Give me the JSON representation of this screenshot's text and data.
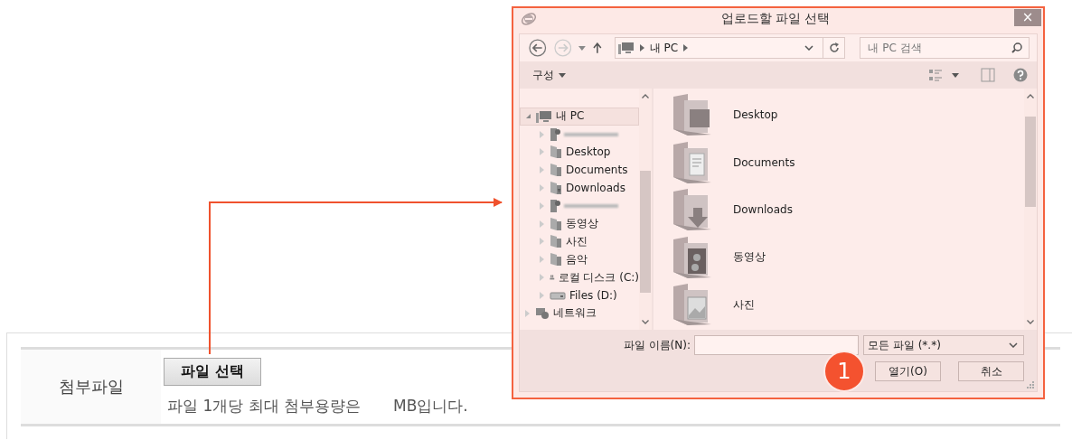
{
  "dialog": {
    "title": "업로드할 파일 선택",
    "close_label": "×",
    "address": {
      "path": [
        "내 PC"
      ]
    },
    "search": {
      "placeholder": "내 PC 검색"
    },
    "toolbar": {
      "organize": "구성"
    },
    "tree": [
      {
        "label": "내 PC",
        "kind": "computer",
        "expanded": true,
        "selected": true,
        "children": [
          {
            "kind": "redacted",
            "expanded": false,
            "selected": false
          },
          {
            "label": "Desktop",
            "kind": "desktop",
            "expanded": false,
            "selected": false
          },
          {
            "label": "Documents",
            "kind": "documents",
            "expanded": false,
            "selected": false
          },
          {
            "label": "Downloads",
            "kind": "downloads",
            "expanded": false,
            "selected": false
          },
          {
            "kind": "redacted",
            "expanded": false,
            "selected": false
          },
          {
            "label": "동영상",
            "kind": "videos",
            "expanded": false,
            "selected": false
          },
          {
            "label": "사진",
            "kind": "pictures",
            "expanded": false,
            "selected": false
          },
          {
            "label": "음악",
            "kind": "music",
            "expanded": false,
            "selected": false
          },
          {
            "label": "로컬 디스크 (C:)",
            "kind": "system-disk",
            "expanded": false,
            "selected": false
          },
          {
            "label": "Files (D:)",
            "kind": "disk",
            "expanded": false,
            "selected": false
          }
        ]
      },
      {
        "label": "네트워크",
        "kind": "network",
        "expanded": false,
        "selected": false
      }
    ],
    "files": [
      {
        "name": "Desktop",
        "kind": "desktop"
      },
      {
        "name": "Documents",
        "kind": "documents"
      },
      {
        "name": "Downloads",
        "kind": "downloads"
      },
      {
        "name": "동영상",
        "kind": "videos"
      },
      {
        "name": "사진",
        "kind": "pictures"
      }
    ],
    "filename_label": "파일 이름(N):",
    "filetype": "모든 파일 (*.*)",
    "buttons": [
      "열기(O)",
      "취소"
    ]
  },
  "callout": {
    "number": "1"
  },
  "form": {
    "label": "첨부파일",
    "button": "파일 선택",
    "hint": "파일 1개당 최대 첨부용량은",
    "unit": "MB입니다."
  }
}
